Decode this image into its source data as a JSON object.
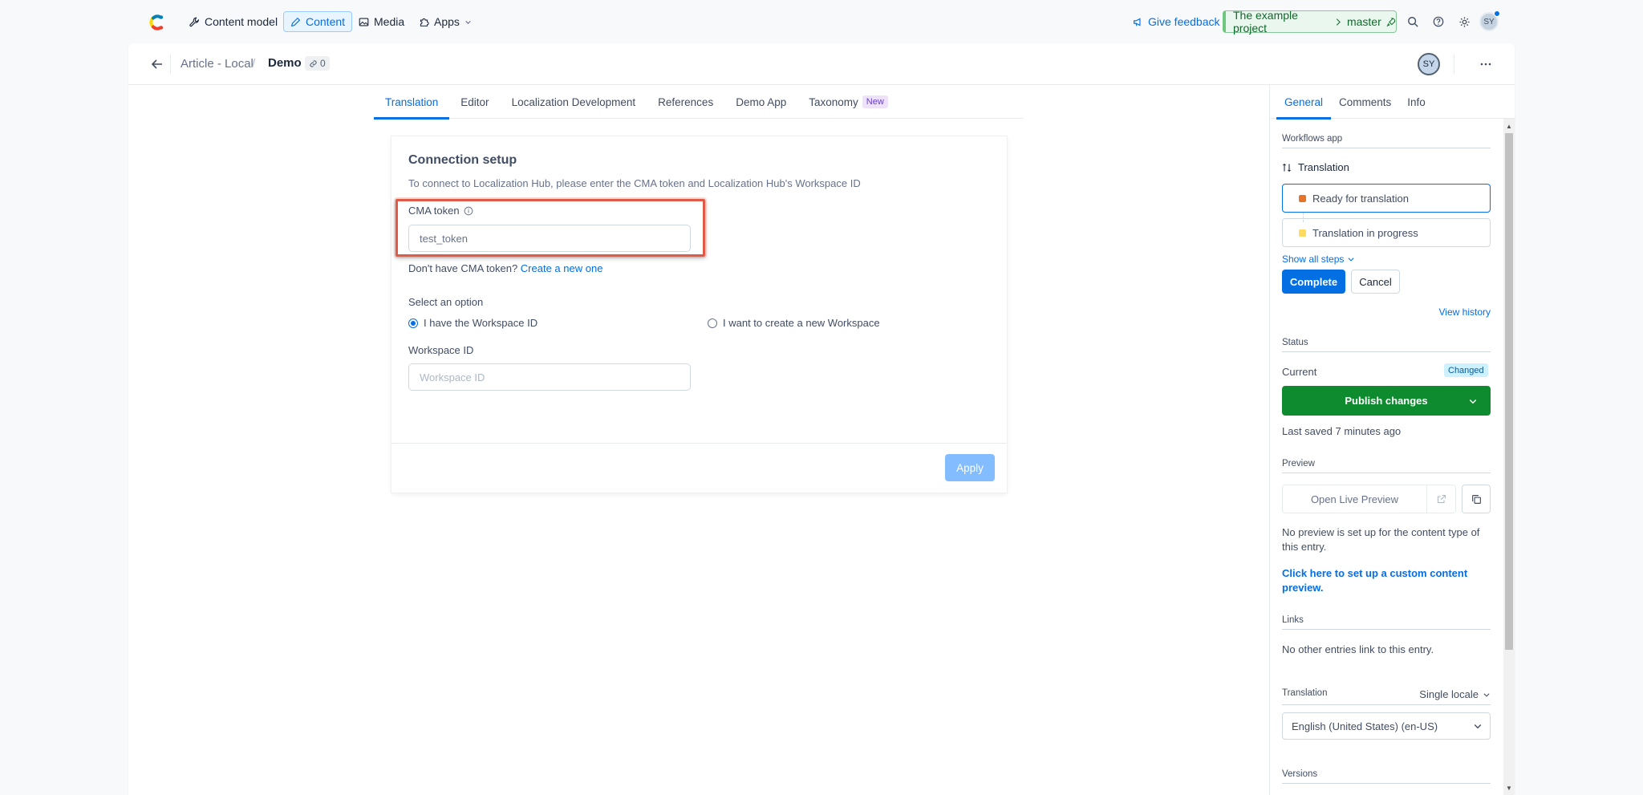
{
  "topnav": {
    "items": [
      {
        "label": "Content model",
        "icon": "wrench-icon"
      },
      {
        "label": "Content",
        "icon": "pen-icon"
      },
      {
        "label": "Media",
        "icon": "image-icon"
      },
      {
        "label": "Apps",
        "icon": "puzzle-icon"
      }
    ],
    "feedback_label": "Give feedback",
    "env_project": "The example project",
    "env_branch": "master",
    "avatar_initials": "SY"
  },
  "entry": {
    "content_type": "Article - Local",
    "title": "Demo",
    "link_count": "0",
    "avatar_initials": "SY"
  },
  "tabs": [
    {
      "label": "Translation"
    },
    {
      "label": "Editor"
    },
    {
      "label": "Localization Development"
    },
    {
      "label": "References"
    },
    {
      "label": "Demo App"
    },
    {
      "label": "Taxonomy",
      "badge": "New"
    }
  ],
  "connection": {
    "title": "Connection setup",
    "description": "To connect to Localization Hub, please enter the CMA token and Localization Hub's Workspace ID",
    "cma_label": "CMA token",
    "cma_value": "test_token",
    "hint_text": "Don't have CMA token?",
    "hint_link": "Create a new one",
    "option_label": "Select an option",
    "option_have": "I have the Workspace ID",
    "option_create": "I want to create a new Workspace",
    "workspace_label": "Workspace ID",
    "workspace_placeholder": "Workspace ID",
    "apply_label": "Apply"
  },
  "sidebar": {
    "tabs": [
      "General",
      "Comments",
      "Info"
    ],
    "workflows_heading": "Workflows app",
    "workflow_name": "Translation",
    "steps": [
      {
        "label": "Ready for translation",
        "color": "#e8742c"
      },
      {
        "label": "Translation in progress",
        "color": "#ffd960"
      }
    ],
    "show_all_steps": "Show all steps",
    "complete_label": "Complete",
    "cancel_label": "Cancel",
    "view_history": "View history",
    "status_heading": "Status",
    "current_label": "Current",
    "changed_badge": "Changed",
    "publish_label": "Publish changes",
    "last_saved": "Last saved 7 minutes ago",
    "preview_heading": "Preview",
    "open_preview": "Open Live Preview",
    "no_preview": "No preview is set up for the content type of this entry.",
    "setup_preview_link": "Click here to set up a custom content preview.",
    "links_heading": "Links",
    "no_links": "No other entries link to this entry.",
    "translation_heading": "Translation",
    "locale_mode": "Single locale",
    "locale_value": "English (United States) (en-US)",
    "versions_heading": "Versions"
  }
}
